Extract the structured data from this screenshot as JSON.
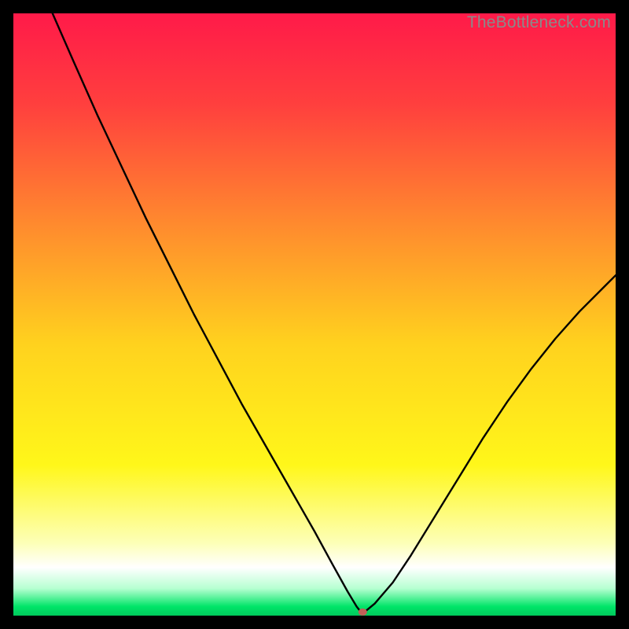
{
  "watermark": "TheBottleneck.com",
  "chart_data": {
    "type": "line",
    "xlabel": "",
    "ylabel": "",
    "xlim": [
      0,
      100
    ],
    "ylim": [
      0,
      100
    ],
    "grid": false,
    "background_gradient": {
      "stops": [
        {
          "offset": 0.0,
          "color": "#ff1a49"
        },
        {
          "offset": 0.15,
          "color": "#ff3f3e"
        },
        {
          "offset": 0.35,
          "color": "#ff8a2e"
        },
        {
          "offset": 0.55,
          "color": "#ffd21e"
        },
        {
          "offset": 0.75,
          "color": "#fff71a"
        },
        {
          "offset": 0.88,
          "color": "#fdffb8"
        },
        {
          "offset": 0.92,
          "color": "#ffffff"
        },
        {
          "offset": 0.955,
          "color": "#b6ffd1"
        },
        {
          "offset": 0.985,
          "color": "#00e568"
        },
        {
          "offset": 1.0,
          "color": "#00c95c"
        }
      ]
    },
    "series": [
      {
        "name": "bottleneck-curve",
        "stroke": "#000000",
        "stroke_width": 2.4,
        "x": [
          6.5,
          10,
          14,
          18,
          22,
          26,
          30,
          34,
          38,
          42,
          46,
          50,
          53,
          55.5,
          57.0,
          57.7,
          58.3,
          60,
          63,
          66,
          70,
          74,
          78,
          82,
          86,
          90,
          94,
          98,
          100
        ],
        "y": [
          100,
          92,
          83,
          74.5,
          66,
          58,
          50,
          42.5,
          35,
          28,
          21,
          14,
          8.5,
          4.0,
          1.5,
          0.6,
          0.6,
          2.0,
          5.5,
          10.0,
          16.5,
          23.0,
          29.5,
          35.5,
          41.0,
          46.0,
          50.5,
          54.5,
          56.5
        ]
      }
    ],
    "marker": {
      "name": "circle-marker",
      "x": 58.0,
      "y": 0.6,
      "rx": 5.5,
      "ry": 4.5,
      "fill": "#c06058"
    }
  }
}
